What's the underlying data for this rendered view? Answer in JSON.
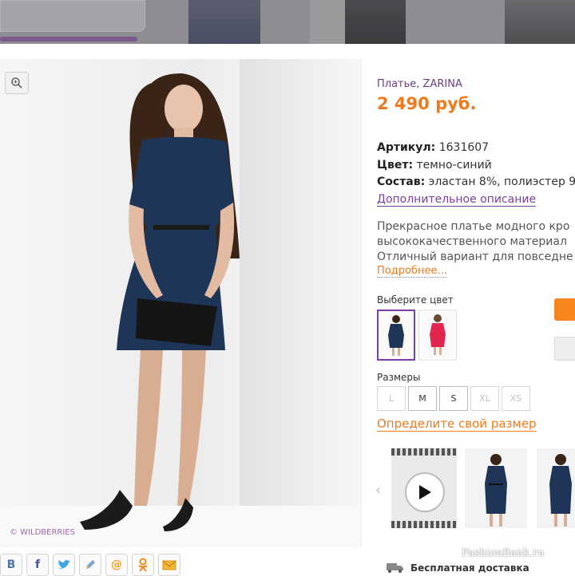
{
  "product": {
    "brand_line": "Платье, ZARINA",
    "price": "2 490 руб.",
    "specs": [
      {
        "key": "Артикул:",
        "value": "1631607"
      },
      {
        "key": "Цвет:",
        "value": "темно-синий"
      },
      {
        "key": "Состав:",
        "value": "эластан 8%, полиэстер 9"
      }
    ],
    "extra_description_link": "Дополнительное описание",
    "description_lines": [
      "Прекрасное платье модного кро",
      "высококачественного материал",
      "Отличный вариант для повседне"
    ],
    "more_link": "Подробнее...",
    "color_label": "Выберите цвет",
    "colors": [
      "navy",
      "red"
    ],
    "sizes_label": "Размеры",
    "sizes": [
      {
        "label": "L",
        "available": false
      },
      {
        "label": "M",
        "available": true
      },
      {
        "label": "S",
        "available": true
      },
      {
        "label": "XL",
        "available": false
      },
      {
        "label": "XS",
        "available": false
      }
    ],
    "size_link": "Определите свой размер"
  },
  "photo": {
    "watermark": "© WILDBERRIES"
  },
  "footer": {
    "share_icons": [
      "B",
      "f",
      "twitter-bird",
      "pencil",
      "@",
      "ok",
      "mail"
    ],
    "delivery": "Бесплатная доставка",
    "site_watermark": "FashionBank.ru"
  },
  "colors": {
    "price_orange": "#f07a1b",
    "brand_purple": "#6b3c86",
    "dress_navy": "#1f3558",
    "dress_red": "#e2264f"
  }
}
